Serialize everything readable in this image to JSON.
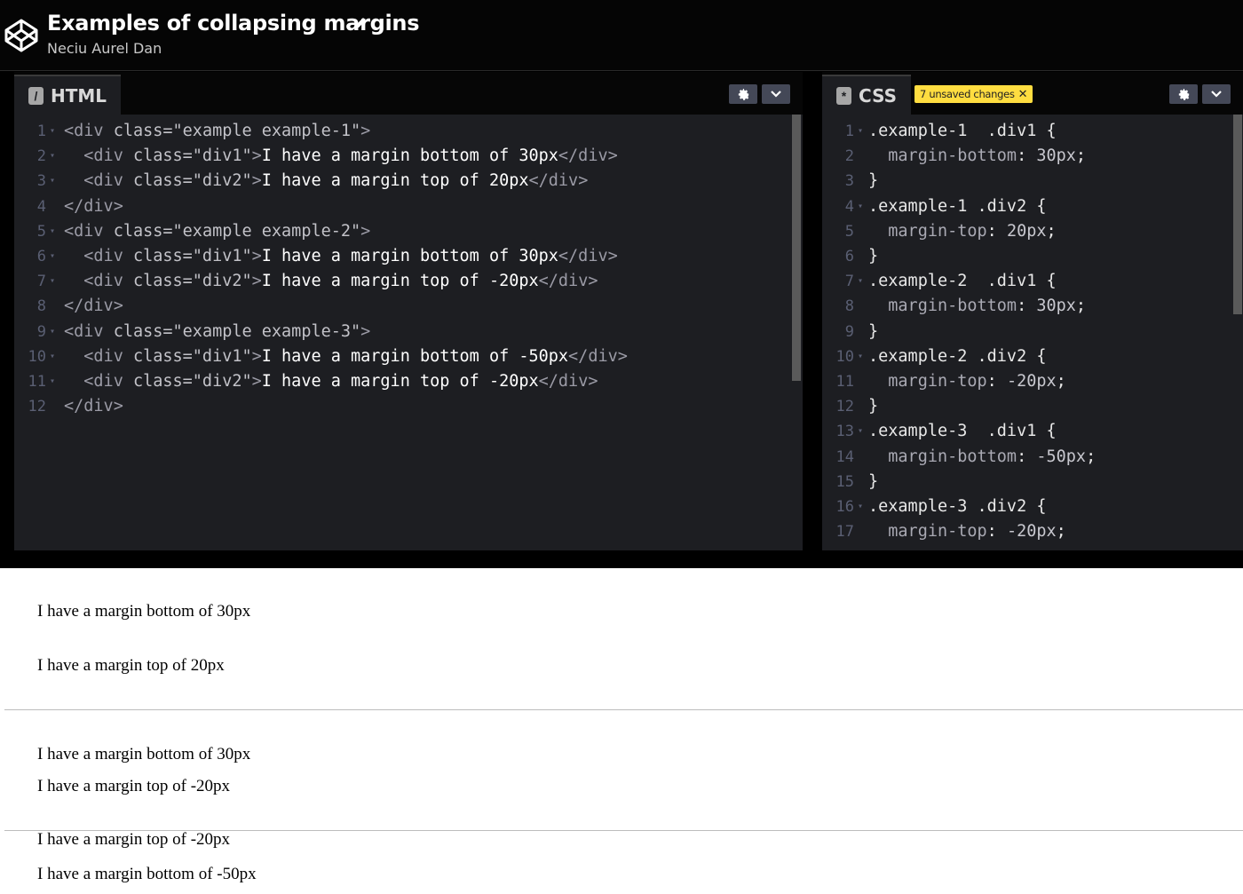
{
  "header": {
    "title": "Examples of collapsing margins",
    "author": "Neciu Aurel Dan"
  },
  "html_pane": {
    "tab_label": "HTML",
    "lines": [
      {
        "n": "1",
        "fold": true,
        "parts": [
          [
            "tag",
            "<div "
          ],
          [
            "attr",
            "class="
          ],
          [
            "str",
            "\"example example-1\""
          ],
          [
            "tag",
            ">"
          ]
        ]
      },
      {
        "n": "2",
        "fold": true,
        "parts": [
          [
            "tag",
            "  <div "
          ],
          [
            "attr",
            "class="
          ],
          [
            "str",
            "\"div1\""
          ],
          [
            "tag",
            ">"
          ],
          [
            "txt",
            "I have a margin bottom of 30px"
          ],
          [
            "tag",
            "</div>"
          ]
        ]
      },
      {
        "n": "3",
        "fold": true,
        "parts": [
          [
            "tag",
            "  <div "
          ],
          [
            "attr",
            "class="
          ],
          [
            "str",
            "\"div2\""
          ],
          [
            "tag",
            ">"
          ],
          [
            "txt",
            "I have a margin top of 20px"
          ],
          [
            "tag",
            "</div>"
          ]
        ]
      },
      {
        "n": "4",
        "fold": false,
        "parts": [
          [
            "tag",
            "</div>"
          ]
        ]
      },
      {
        "n": "5",
        "fold": true,
        "parts": [
          [
            "tag",
            "<div "
          ],
          [
            "attr",
            "class="
          ],
          [
            "str",
            "\"example example-2\""
          ],
          [
            "tag",
            ">"
          ]
        ]
      },
      {
        "n": "6",
        "fold": true,
        "parts": [
          [
            "tag",
            "  <div "
          ],
          [
            "attr",
            "class="
          ],
          [
            "str",
            "\"div1\""
          ],
          [
            "tag",
            ">"
          ],
          [
            "txt",
            "I have a margin bottom of 30px"
          ],
          [
            "tag",
            "</div>"
          ]
        ]
      },
      {
        "n": "7",
        "fold": true,
        "parts": [
          [
            "tag",
            "  <div "
          ],
          [
            "attr",
            "class="
          ],
          [
            "str",
            "\"div2\""
          ],
          [
            "tag",
            ">"
          ],
          [
            "txt",
            "I have a margin top of -20px"
          ],
          [
            "tag",
            "</div>"
          ]
        ]
      },
      {
        "n": "8",
        "fold": false,
        "parts": [
          [
            "tag",
            "</div>"
          ]
        ]
      },
      {
        "n": "9",
        "fold": true,
        "parts": [
          [
            "tag",
            "<div "
          ],
          [
            "attr",
            "class="
          ],
          [
            "str",
            "\"example example-3\""
          ],
          [
            "tag",
            ">"
          ]
        ]
      },
      {
        "n": "10",
        "fold": true,
        "parts": [
          [
            "tag",
            "  <div "
          ],
          [
            "attr",
            "class="
          ],
          [
            "str",
            "\"div1\""
          ],
          [
            "tag",
            ">"
          ],
          [
            "txt",
            "I have a margin bottom of -50px"
          ],
          [
            "tag",
            "</div>"
          ]
        ]
      },
      {
        "n": "11",
        "fold": true,
        "parts": [
          [
            "tag",
            "  <div "
          ],
          [
            "attr",
            "class="
          ],
          [
            "str",
            "\"div2\""
          ],
          [
            "tag",
            ">"
          ],
          [
            "txt",
            "I have a margin top of -20px"
          ],
          [
            "tag",
            "</div>"
          ]
        ]
      },
      {
        "n": "12",
        "fold": false,
        "parts": [
          [
            "tag",
            "</div>"
          ]
        ]
      }
    ]
  },
  "css_pane": {
    "tab_label": "CSS",
    "unsaved_badge": "7 unsaved changes",
    "lines": [
      {
        "n": "1",
        "fold": true,
        "parts": [
          [
            "sel",
            ".example-1  .div1 {"
          ]
        ]
      },
      {
        "n": "2",
        "fold": false,
        "parts": [
          [
            "prop",
            "  margin-bottom"
          ],
          [
            "sel",
            ": "
          ],
          [
            "val",
            "30px"
          ],
          [
            "sel",
            ";"
          ]
        ]
      },
      {
        "n": "3",
        "fold": false,
        "parts": [
          [
            "sel",
            "}"
          ]
        ]
      },
      {
        "n": "4",
        "fold": true,
        "parts": [
          [
            "sel",
            ".example-1 .div2 {"
          ]
        ]
      },
      {
        "n": "5",
        "fold": false,
        "parts": [
          [
            "prop",
            "  margin-top"
          ],
          [
            "sel",
            ": "
          ],
          [
            "val",
            "20px"
          ],
          [
            "sel",
            ";"
          ]
        ]
      },
      {
        "n": "6",
        "fold": false,
        "parts": [
          [
            "sel",
            "}"
          ]
        ]
      },
      {
        "n": "7",
        "fold": true,
        "parts": [
          [
            "sel",
            ".example-2  .div1 {"
          ]
        ]
      },
      {
        "n": "8",
        "fold": false,
        "parts": [
          [
            "prop",
            "  margin-bottom"
          ],
          [
            "sel",
            ": "
          ],
          [
            "val",
            "30px"
          ],
          [
            "sel",
            ";"
          ]
        ]
      },
      {
        "n": "9",
        "fold": false,
        "parts": [
          [
            "sel",
            "}"
          ]
        ]
      },
      {
        "n": "10",
        "fold": true,
        "parts": [
          [
            "sel",
            ".example-2 .div2 {"
          ]
        ]
      },
      {
        "n": "11",
        "fold": false,
        "parts": [
          [
            "prop",
            "  margin-top"
          ],
          [
            "sel",
            ": "
          ],
          [
            "val",
            "-20px"
          ],
          [
            "sel",
            ";"
          ]
        ]
      },
      {
        "n": "12",
        "fold": false,
        "parts": [
          [
            "sel",
            "}"
          ]
        ]
      },
      {
        "n": "13",
        "fold": true,
        "parts": [
          [
            "sel",
            ".example-3  .div1 {"
          ]
        ]
      },
      {
        "n": "14",
        "fold": false,
        "parts": [
          [
            "prop",
            "  margin-bottom"
          ],
          [
            "sel",
            ": "
          ],
          [
            "val",
            "-50px"
          ],
          [
            "sel",
            ";"
          ]
        ]
      },
      {
        "n": "15",
        "fold": false,
        "parts": [
          [
            "sel",
            "}"
          ]
        ]
      },
      {
        "n": "16",
        "fold": true,
        "parts": [
          [
            "sel",
            ".example-3 .div2 {"
          ]
        ]
      },
      {
        "n": "17",
        "fold": false,
        "parts": [
          [
            "prop",
            "  margin-top"
          ],
          [
            "sel",
            ": "
          ],
          [
            "val",
            "-20px"
          ],
          [
            "sel",
            ";"
          ]
        ]
      }
    ]
  },
  "preview": {
    "example1_div1": "I have a margin bottom of 30px",
    "example1_div2": "I have a margin top of 20px",
    "example2_div1": "I have a margin bottom of 30px",
    "example2_div2": "I have a margin top of -20px",
    "example3_div2": "I have a margin top of -20px",
    "example3_div1": "I have a margin bottom of -50px"
  },
  "colors": {
    "editor_bg": "#1d1e22",
    "badge_bg": "#ffdd40",
    "button_bg": "#444857"
  }
}
